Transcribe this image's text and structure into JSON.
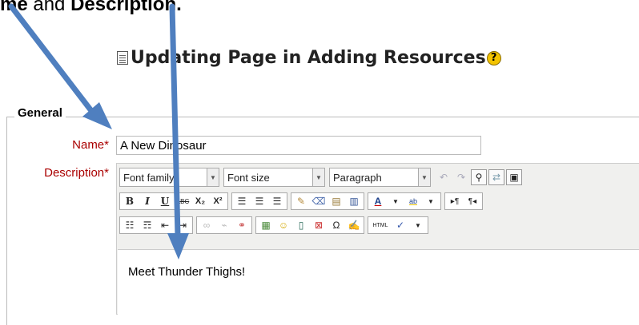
{
  "caption": {
    "part1": "me",
    "connector": " and ",
    "part2": "Description."
  },
  "page": {
    "title": "Updating Page in Adding Resources",
    "help_symbol": "?"
  },
  "form": {
    "legend": "General",
    "name_label": "Name",
    "description_label": "Description",
    "required_mark": "*",
    "name_value": "A New Dinosaur"
  },
  "toolbar": {
    "font_family": "Font family",
    "font_size": "Font size",
    "format": "Paragraph",
    "bold": "B",
    "italic": "I",
    "underline": "U",
    "strike": "ABC",
    "subscript": "X₂",
    "superscript": "X²",
    "text_color": "A",
    "html": "HTML",
    "omega": "Ω"
  },
  "editor": {
    "content": "Meet Thunder Thighs!"
  },
  "colors": {
    "arrow": "#4f7fbf",
    "required": "#aa0000"
  }
}
